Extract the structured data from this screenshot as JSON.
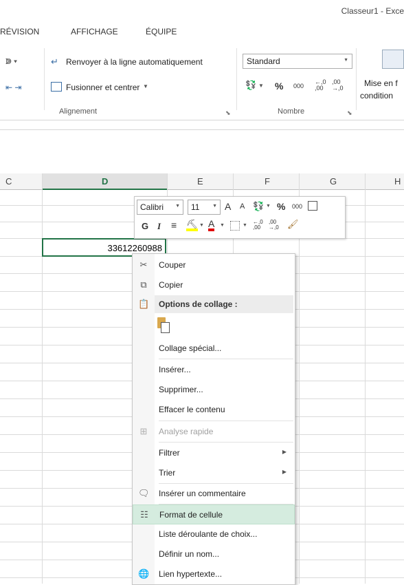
{
  "window": {
    "title": "Classeur1 - Exce"
  },
  "tabs": [
    "RÉVISION",
    "AFFICHAGE",
    "ÉQUIPE"
  ],
  "ribbon": {
    "wrap_text": "Renvoyer à la ligne automatiquement",
    "merge_center": "Fusionner et centrer",
    "number_format": "Standard",
    "percent": "%",
    "thousands": "000",
    "inc_decimal": "←,0 ,00",
    "dec_decimal": ",00 →,0",
    "cond_format_1": "Mise en f",
    "cond_format_2": "condition",
    "group_alignment": "Alignement",
    "group_number": "Nombre"
  },
  "grid": {
    "columns": [
      "C",
      "D",
      "E",
      "F",
      "G",
      "H"
    ],
    "active_cell_value": "33612260988"
  },
  "mini_toolbar": {
    "font": "Calibri",
    "size": "11",
    "bold": "G",
    "italic": "I",
    "percent": "%",
    "thousands": "000",
    "grow": "A",
    "shrink": "A"
  },
  "context_menu": {
    "cut": "Couper",
    "copy": "Copier",
    "paste_options": "Options de collage :",
    "paste_special": "Collage spécial...",
    "insert": "Insérer...",
    "delete": "Supprimer...",
    "clear": "Effacer le contenu",
    "quick_analysis": "Analyse rapide",
    "filter": "Filtrer",
    "sort": "Trier",
    "insert_comment": "Insérer un commentaire",
    "format_cells": "Format de cellule",
    "dropdown_list": "Liste déroulante de choix...",
    "define_name": "Définir un nom...",
    "hyperlink": "Lien hypertexte..."
  },
  "colors": {
    "accent": "#217346",
    "highlight": "#d5ecdf"
  }
}
